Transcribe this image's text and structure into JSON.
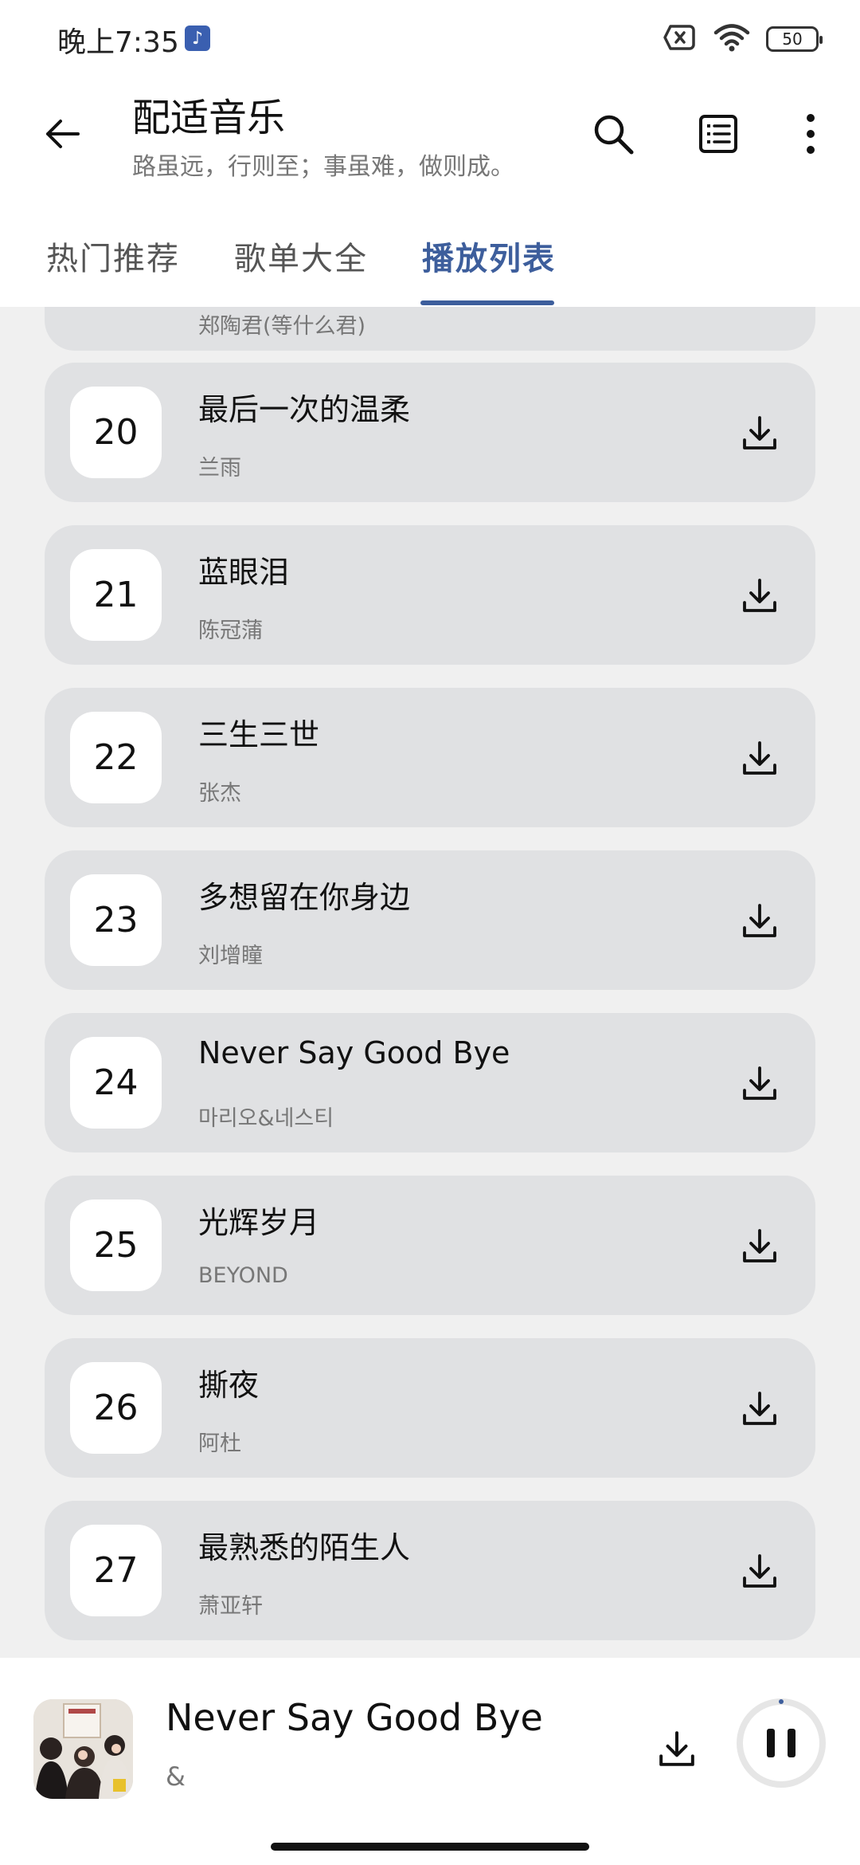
{
  "status_bar": {
    "time": "晚上7:35",
    "battery": "50",
    "icons": [
      "music-note-icon",
      "sim-off-icon",
      "wifi-icon",
      "battery-icon"
    ]
  },
  "app_bar": {
    "title": "配适音乐",
    "subtitle": "路虽远，行则至；事虽难，做则成。",
    "icons": [
      "back-arrow-icon",
      "search-icon",
      "list-icon",
      "more-vert-icon"
    ]
  },
  "tabs": [
    {
      "label": "热门推荐",
      "active": false
    },
    {
      "label": "歌单大全",
      "active": false
    },
    {
      "label": "播放列表",
      "active": true
    }
  ],
  "playlist": {
    "partial_item": {
      "artist": "郑陶君(等什么君)"
    },
    "items": [
      {
        "index": "20",
        "title": "最后一次的温柔",
        "artist": "兰雨"
      },
      {
        "index": "21",
        "title": "蓝眼泪",
        "artist": "陈冠蒲"
      },
      {
        "index": "22",
        "title": "三生三世",
        "artist": "张杰"
      },
      {
        "index": "23",
        "title": "多想留在你身边",
        "artist": "刘增瞳"
      },
      {
        "index": "24",
        "title": "Never Say Good Bye",
        "artist": "마리오&네스티"
      },
      {
        "index": "25",
        "title": "光辉岁月",
        "artist": "BEYOND"
      },
      {
        "index": "26",
        "title": "撕夜",
        "artist": "阿杜"
      },
      {
        "index": "27",
        "title": "最熟悉的陌生人",
        "artist": "萧亚轩"
      }
    ]
  },
  "player": {
    "title": "Never Say Good Bye",
    "artist": "&",
    "progress": 0.01,
    "accent_color": "#3d5e9c"
  }
}
